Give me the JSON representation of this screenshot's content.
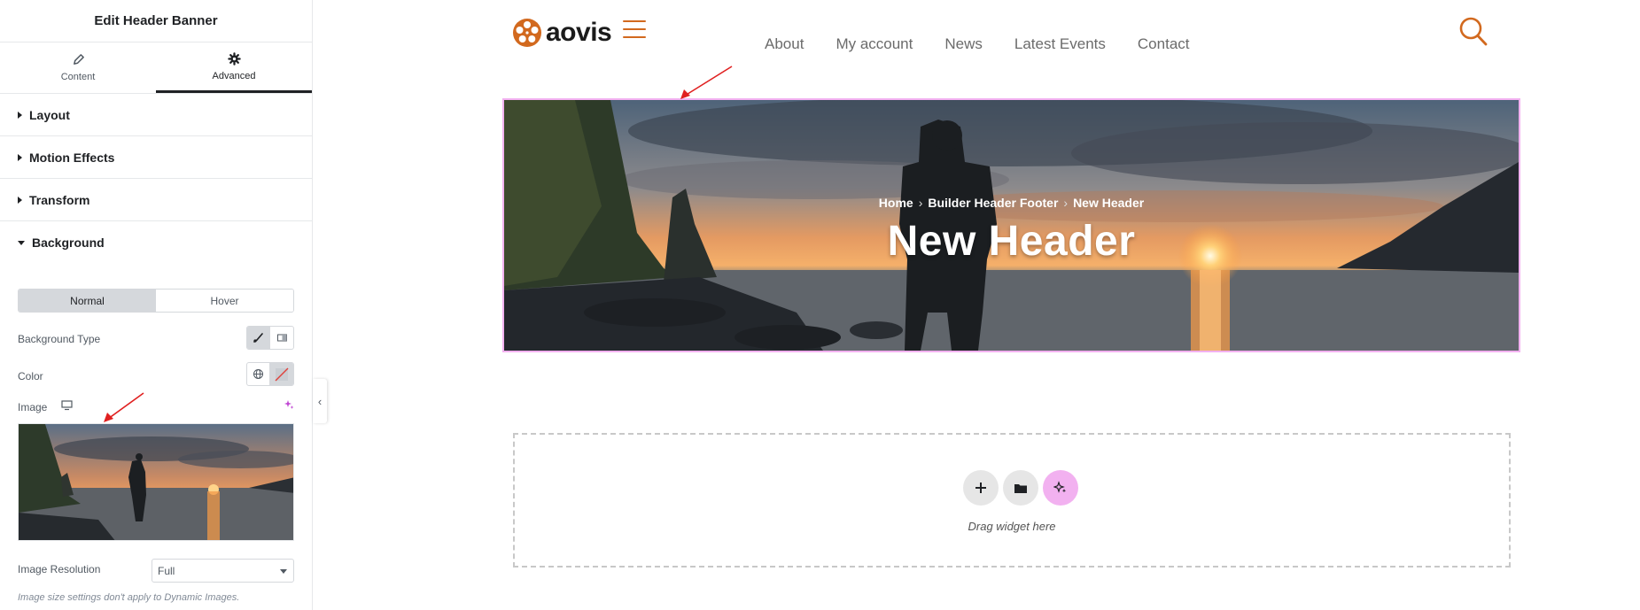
{
  "panel": {
    "title": "Edit Header Banner",
    "tabs": [
      {
        "label": "Content",
        "icon": "pencil-icon",
        "active": false
      },
      {
        "label": "Advanced",
        "icon": "gear-icon",
        "active": true
      }
    ],
    "sections": [
      {
        "label": "Layout"
      },
      {
        "label": "Motion Effects"
      },
      {
        "label": "Transform"
      },
      {
        "label": "Background"
      }
    ],
    "background": {
      "states": [
        "Normal",
        "Hover"
      ],
      "active_state": "Normal",
      "type_label": "Background Type",
      "color_label": "Color",
      "image_label": "Image",
      "resolution_label": "Image Resolution",
      "resolution_value": "Full",
      "resolution_note": "Image size settings don't apply to Dynamic Images."
    }
  },
  "site": {
    "logo_text": "aovis",
    "nav": [
      "About",
      "My account",
      "News",
      "Latest Events",
      "Contact"
    ],
    "accent_color": "#d2691e"
  },
  "banner": {
    "breadcrumb": [
      "Home",
      "Builder Header Footer",
      "New Header"
    ],
    "title": "New Header"
  },
  "dropzone": {
    "text": "Drag widget here"
  }
}
